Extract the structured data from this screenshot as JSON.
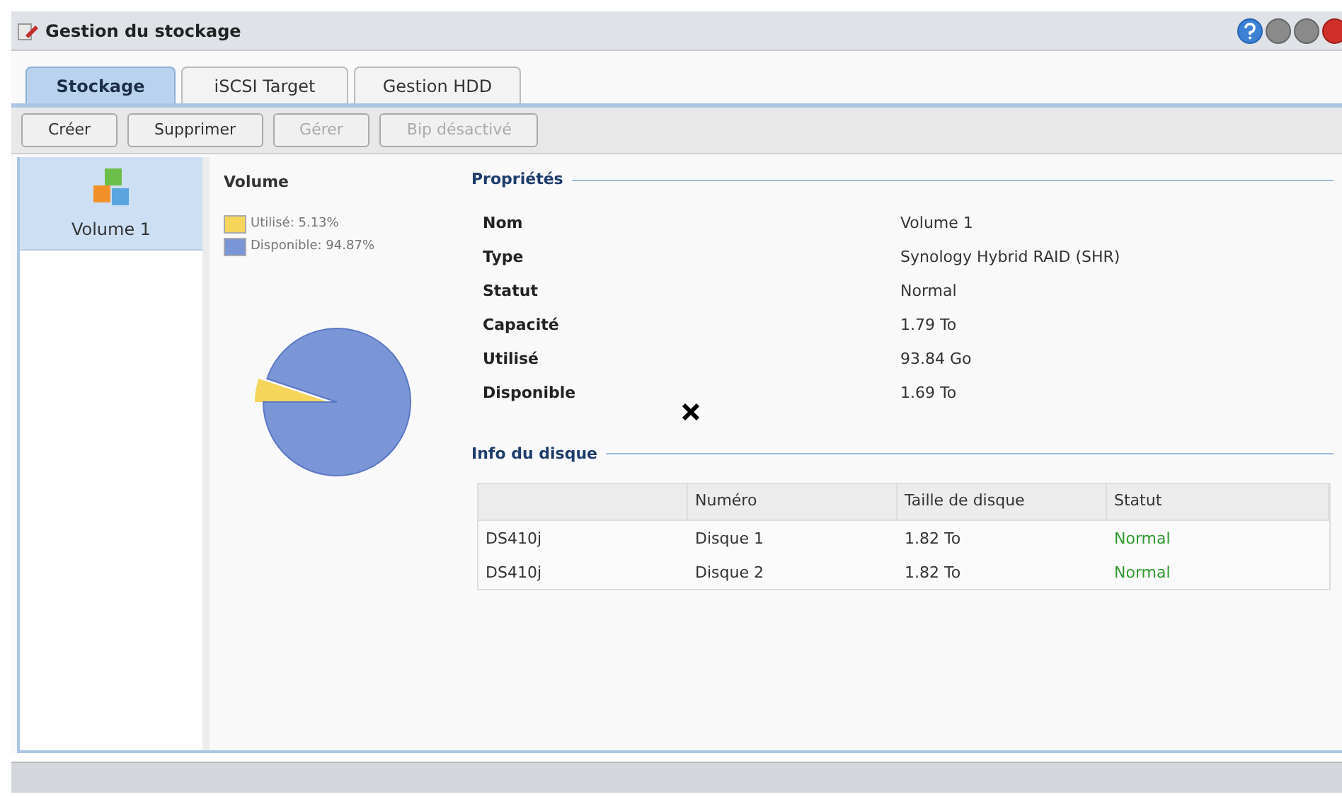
{
  "window": {
    "title": "Gestion du stockage"
  },
  "tabs": [
    {
      "label": "Stockage",
      "selected": true
    },
    {
      "label": "iSCSI Target",
      "selected": false
    },
    {
      "label": "Gestion HDD",
      "selected": false
    }
  ],
  "toolbar": [
    {
      "label": "Créer",
      "disabled": false
    },
    {
      "label": "Supprimer",
      "disabled": false
    },
    {
      "label": "Gérer",
      "disabled": true
    },
    {
      "label": "Bip désactivé",
      "disabled": true
    }
  ],
  "sidebar": {
    "items": [
      {
        "label": "Volume 1",
        "selected": true
      }
    ]
  },
  "volume_chart": {
    "title": "Volume",
    "legend": [
      {
        "label": "Utilisé: 5.13%",
        "color": "#f5d55a"
      },
      {
        "label": "Disponible: 94.87%",
        "color": "#7b96d6"
      }
    ],
    "chart_data": {
      "type": "pie",
      "values": [
        5.13,
        94.87
      ]
    }
  },
  "properties": {
    "title": "Propriétés",
    "rows": [
      {
        "label": "Nom",
        "value": "Volume 1"
      },
      {
        "label": "Type",
        "value": "Synology Hybrid RAID (SHR)"
      },
      {
        "label": "Statut",
        "value": "Normal"
      },
      {
        "label": "Capacité",
        "value": "1.79 To"
      },
      {
        "label": "Utilisé",
        "value": "93.84 Go"
      },
      {
        "label": "Disponible",
        "value": "1.69 To"
      }
    ]
  },
  "disk_info": {
    "title": "Info du disque",
    "columns": [
      "",
      "Numéro",
      "Taille de disque",
      "Statut"
    ],
    "rows": [
      [
        "DS410j",
        "Disque 1",
        "1.82 To",
        "Normal"
      ],
      [
        "DS410j",
        "Disque 2",
        "1.82 To",
        "Normal"
      ]
    ]
  }
}
